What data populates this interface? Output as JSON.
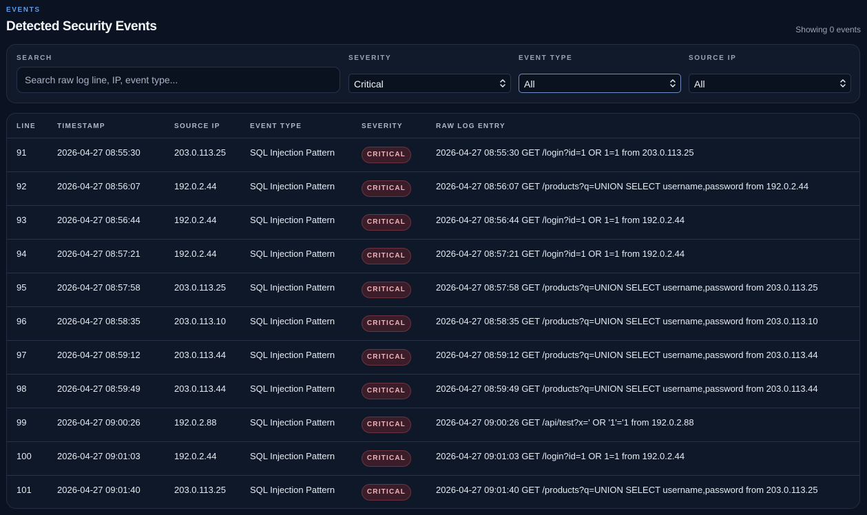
{
  "header": {
    "eyebrow": "EVENTS",
    "title": "Detected Security Events",
    "count_text": "Showing 0 events"
  },
  "filters": {
    "search": {
      "label": "SEARCH",
      "placeholder": "Search raw log line, IP, event type...",
      "value": ""
    },
    "severity": {
      "label": "SEVERITY",
      "value": "Critical"
    },
    "event_type": {
      "label": "EVENT TYPE",
      "value": "All"
    },
    "source_ip": {
      "label": "SOURCE IP",
      "value": "All"
    }
  },
  "table": {
    "columns": [
      "LINE",
      "TIMESTAMP",
      "SOURCE IP",
      "EVENT TYPE",
      "SEVERITY",
      "RAW LOG ENTRY"
    ],
    "rows": [
      {
        "line": "91",
        "timestamp": "2026-04-27 08:55:30",
        "source_ip": "203.0.113.25",
        "event_type": "SQL Injection Pattern",
        "severity": "CRITICAL",
        "raw": "2026-04-27 08:55:30 GET /login?id=1 OR 1=1 from 203.0.113.25"
      },
      {
        "line": "92",
        "timestamp": "2026-04-27 08:56:07",
        "source_ip": "192.0.2.44",
        "event_type": "SQL Injection Pattern",
        "severity": "CRITICAL",
        "raw": "2026-04-27 08:56:07 GET /products?q=UNION SELECT username,password from 192.0.2.44"
      },
      {
        "line": "93",
        "timestamp": "2026-04-27 08:56:44",
        "source_ip": "192.0.2.44",
        "event_type": "SQL Injection Pattern",
        "severity": "CRITICAL",
        "raw": "2026-04-27 08:56:44 GET /login?id=1 OR 1=1 from 192.0.2.44"
      },
      {
        "line": "94",
        "timestamp": "2026-04-27 08:57:21",
        "source_ip": "192.0.2.44",
        "event_type": "SQL Injection Pattern",
        "severity": "CRITICAL",
        "raw": "2026-04-27 08:57:21 GET /login?id=1 OR 1=1 from 192.0.2.44"
      },
      {
        "line": "95",
        "timestamp": "2026-04-27 08:57:58",
        "source_ip": "203.0.113.25",
        "event_type": "SQL Injection Pattern",
        "severity": "CRITICAL",
        "raw": "2026-04-27 08:57:58 GET /products?q=UNION SELECT username,password from 203.0.113.25"
      },
      {
        "line": "96",
        "timestamp": "2026-04-27 08:58:35",
        "source_ip": "203.0.113.10",
        "event_type": "SQL Injection Pattern",
        "severity": "CRITICAL",
        "raw": "2026-04-27 08:58:35 GET /products?q=UNION SELECT username,password from 203.0.113.10"
      },
      {
        "line": "97",
        "timestamp": "2026-04-27 08:59:12",
        "source_ip": "203.0.113.44",
        "event_type": "SQL Injection Pattern",
        "severity": "CRITICAL",
        "raw": "2026-04-27 08:59:12 GET /products?q=UNION SELECT username,password from 203.0.113.44"
      },
      {
        "line": "98",
        "timestamp": "2026-04-27 08:59:49",
        "source_ip": "203.0.113.44",
        "event_type": "SQL Injection Pattern",
        "severity": "CRITICAL",
        "raw": "2026-04-27 08:59:49 GET /products?q=UNION SELECT username,password from 203.0.113.44"
      },
      {
        "line": "99",
        "timestamp": "2026-04-27 09:00:26",
        "source_ip": "192.0.2.88",
        "event_type": "SQL Injection Pattern",
        "severity": "CRITICAL",
        "raw": "2026-04-27 09:00:26 GET /api/test?x=' OR '1'='1 from 192.0.2.88"
      },
      {
        "line": "100",
        "timestamp": "2026-04-27 09:01:03",
        "source_ip": "192.0.2.44",
        "event_type": "SQL Injection Pattern",
        "severity": "CRITICAL",
        "raw": "2026-04-27 09:01:03 GET /login?id=1 OR 1=1 from 192.0.2.44"
      },
      {
        "line": "101",
        "timestamp": "2026-04-27 09:01:40",
        "source_ip": "203.0.113.25",
        "event_type": "SQL Injection Pattern",
        "severity": "CRITICAL",
        "raw": "2026-04-27 09:01:40 GET /products?q=UNION SELECT username,password from 203.0.113.25"
      }
    ]
  },
  "colors": {
    "background": "#0b1322",
    "accent": "#5b9cf0",
    "critical_badge_bg": "#3a1d28",
    "critical_badge_text": "#f0b3bb"
  },
  "icons": {
    "select_chevron": "chevron-up-down-icon"
  }
}
